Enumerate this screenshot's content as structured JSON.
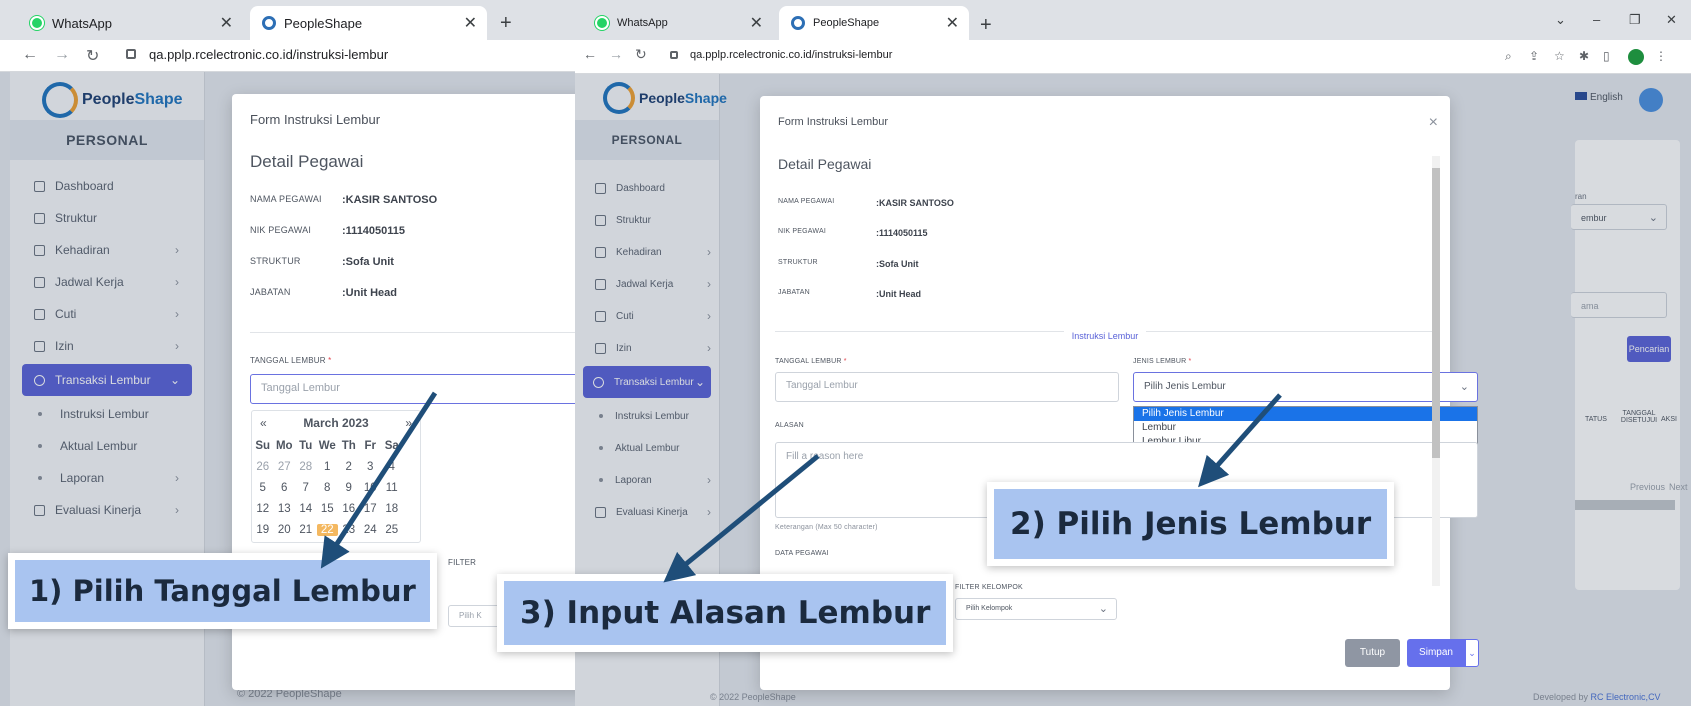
{
  "browser": {
    "tabs": [
      {
        "label": "WhatsApp"
      },
      {
        "label": "PeopleShape"
      }
    ],
    "url": "qa.pplp.rcelectronic.co.id/instruksi-lembur"
  },
  "app": {
    "logo_brand_1": "People",
    "logo_brand_2": "Shape",
    "section": "PERSONAL",
    "menu": [
      {
        "label": "Dashboard",
        "icon": "home-icon"
      },
      {
        "label": "Struktur",
        "icon": "sitemap-icon"
      },
      {
        "label": "Kehadiran",
        "icon": "fingerprint-icon"
      },
      {
        "label": "Jadwal Kerja",
        "icon": "briefcase-icon"
      },
      {
        "label": "Cuti",
        "icon": "calendar-icon"
      },
      {
        "label": "Izin",
        "icon": "calendar-icon"
      },
      {
        "label": "Transaksi Lembur",
        "icon": "clock-icon"
      },
      {
        "label": "Instruksi Lembur"
      },
      {
        "label": "Aktual Lembur"
      },
      {
        "label": "Laporan"
      },
      {
        "label": "Evaluasi Kinerja",
        "icon": "chart-icon"
      }
    ],
    "lang": "English",
    "footer": "© 2022 PeopleShape",
    "developed_by": "Developed by ",
    "developer": "RC Electronic,CV",
    "search_button": "Pencarian",
    "name_placeholder": "ama",
    "filter_partial": "ran",
    "filter_value_partial": "embur",
    "table_headers": [
      "TATUS",
      "TANGGAL DISETUJUI",
      "AKSI"
    ],
    "pager": [
      "Previous",
      "Next"
    ]
  },
  "form": {
    "title": "Form Instruksi Lembur",
    "subtitle": "Detail Pegawai",
    "fields": [
      {
        "k": "NAMA PEGAWAI",
        "v": "KASIR SANTOSO"
      },
      {
        "k": "NIK PEGAWAI",
        "v": "1114050115"
      },
      {
        "k": "STRUKTUR",
        "v": "Sofa Unit"
      },
      {
        "k": "JABATAN",
        "v": "Unit Head"
      }
    ],
    "section_label": "Instruksi Lembur",
    "tanggal_label": "TANGGAL LEMBUR",
    "tanggal_placeholder": "Tanggal Lembur",
    "jenis_label": "JENIS LEMBUR",
    "jenis_value": "Pilih Jenis Lembur",
    "jenis_options": [
      "Pilih Jenis Lembur",
      "Lembur",
      "Lembur Libur"
    ],
    "alasan_label": "ALASAN",
    "alasan_placeholder": "Fill a reason here",
    "alasan_hint": "Keterangan (Max 50 character)",
    "data_pegawai": "DATA PEGAWAI",
    "filter_kelompok": "FILTER KELOMPOK",
    "filter_partial": "FILTER",
    "kelompok_placeholder": "Pilih Kelompok",
    "kelompok_partial": "Pilih K",
    "close_button": "Tutup",
    "save_button": "Simpan"
  },
  "calendar": {
    "month": "March 2023",
    "prev": "«",
    "next": "»",
    "weekdays": [
      "Su",
      "Mo",
      "Tu",
      "We",
      "Th",
      "Fr",
      "Sa"
    ],
    "weeks": [
      [
        "26",
        "27",
        "28",
        "1",
        "2",
        "3",
        "4"
      ],
      [
        "5",
        "6",
        "7",
        "8",
        "9",
        "10",
        "11"
      ],
      [
        "12",
        "13",
        "14",
        "15",
        "16",
        "17",
        "18"
      ],
      [
        "19",
        "20",
        "21",
        "22",
        "23",
        "24",
        "25"
      ]
    ],
    "today": "22"
  },
  "callouts": [
    "1) Pilih Tanggal Lembur",
    "2) Pilih Jenis Lembur",
    "3) Input Alasan Lembur"
  ],
  "colors": {
    "accent": "#5a62d8",
    "callout_bg": "#a9c4f0",
    "arrow": "#1f4e79"
  }
}
